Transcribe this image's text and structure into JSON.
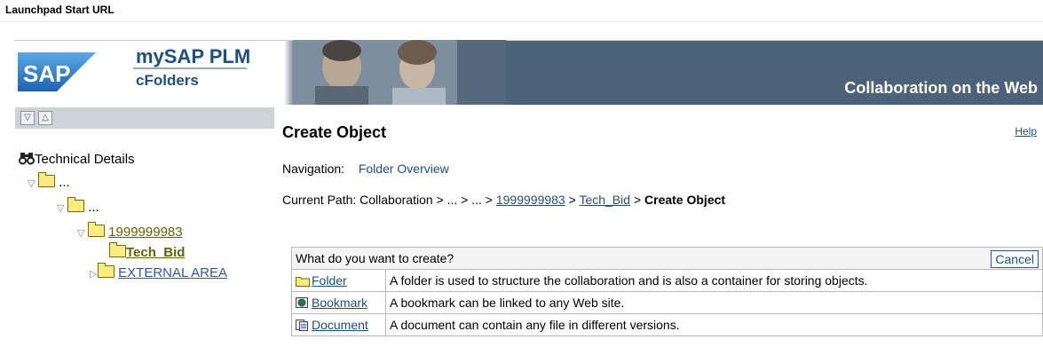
{
  "launchpad": {
    "title": "Launchpad Start URL"
  },
  "header": {
    "product": "mySAP PLM",
    "product_sub": "cFolders",
    "tagline": "Collaboration on the Web",
    "logo_text": "SAP"
  },
  "toolbar": {
    "expand_symbol": "▽",
    "collapse_symbol": "△"
  },
  "tree": {
    "root_label": "Technical Details",
    "items": [
      {
        "label": "..."
      },
      {
        "label": "..."
      },
      {
        "label": "1999999983"
      },
      {
        "label": "Tech_Bid"
      },
      {
        "label": "EXTERNAL AREA"
      }
    ]
  },
  "page": {
    "title": "Create Object",
    "help": "Help",
    "nav_label": "Navigation:",
    "nav_link": "Folder Overview",
    "path_label": "Current Path:",
    "path_prefix": "Collaboration > ... > ... >",
    "path_link1": "1999999983",
    "path_sep1": ">",
    "path_link2": "Tech_Bid",
    "path_sep2": ">",
    "path_current": "Create Object"
  },
  "create_table": {
    "question": "What do you want to create?",
    "cancel": "Cancel",
    "rows": [
      {
        "label": "Folder",
        "description": "A folder is used to structure the collaboration and is also a container for storing objects.",
        "icon": "folder-icon"
      },
      {
        "label": "Bookmark",
        "description": "A bookmark can be linked to any Web site.",
        "icon": "bookmark-icon"
      },
      {
        "label": "Document",
        "description": "A document can contain any file in different versions.",
        "icon": "document-icon"
      }
    ]
  },
  "colors": {
    "brand_blue": "#1d4f85",
    "header_bg": "#4c6278",
    "folder_yellow": "#ffec80"
  }
}
